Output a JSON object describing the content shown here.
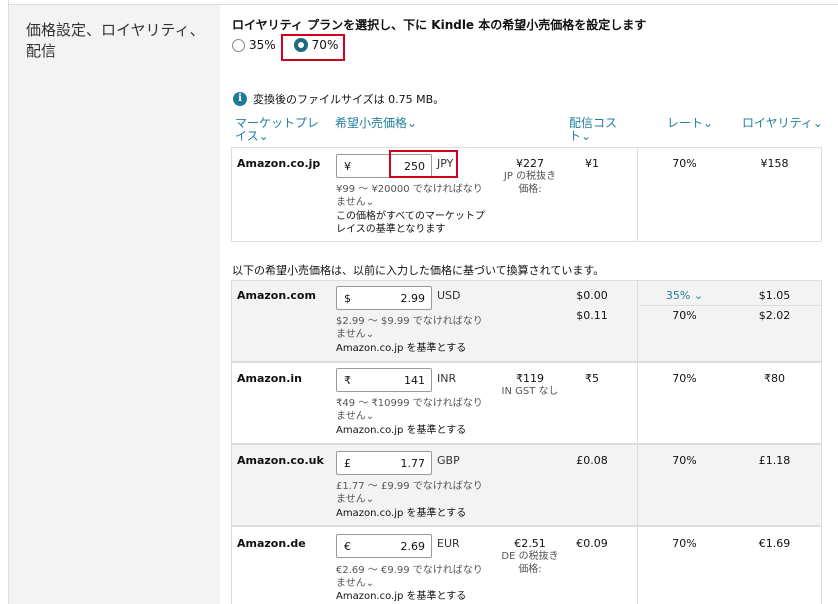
{
  "section": {
    "title": "価格設定、ロイヤリティ、配信"
  },
  "royalty": {
    "heading": "ロイヤリティ プランを選択し、下に Kindle 本の希望小売価格を設定します",
    "option_35": "35%",
    "option_70": "70%",
    "selected": "70%"
  },
  "info": {
    "text": "変換後のファイルサイズは 0.75 MB。"
  },
  "columns": {
    "marketplace": "マーケットプレイス⌄",
    "list_price": "希望小売価格⌄",
    "delivery_cost": "配信コスト⌄",
    "rate": "レート⌄",
    "royalty": "ロイヤリティ⌄"
  },
  "primary": {
    "marketplace": "Amazon.co.jp",
    "symbol": "¥",
    "price": "250",
    "currency": "JPY",
    "range": "¥99 ～ ¥20000 でなければなりません⌄",
    "base_note": "この価格がすべてのマーケットプレイスの基準となります",
    "tax_price": "¥227",
    "tax_note": "JP の税抜き価格:",
    "delivery": "¥1",
    "rate": "70%",
    "royalty": "¥158"
  },
  "converted_note": "以下の希望小売価格は、以前に入力した価格に基づいて換算されています。",
  "rows": [
    {
      "marketplace": "Amazon.com",
      "symbol": "$",
      "price": "2.99",
      "currency": "USD",
      "range": "$2.99 ～ $9.99 でなければなりません⌄",
      "base": "Amazon.co.jp を基準とする",
      "tax_price": "",
      "tax_note": "",
      "delivery": "$0.00",
      "delivery2": "$0.11",
      "rate": "35% ⌄",
      "rate2": "70%",
      "royalty": "$1.05",
      "royalty2": "$2.02"
    },
    {
      "marketplace": "Amazon.in",
      "symbol": "₹",
      "price": "141",
      "currency": "INR",
      "range": "₹49 ～ ₹10999 でなければなりません⌄",
      "base": "Amazon.co.jp を基準とする",
      "tax_price": "₹119",
      "tax_note": "IN GST なし",
      "delivery": "₹5",
      "rate": "70%",
      "royalty": "₹80"
    },
    {
      "marketplace": "Amazon.co.uk",
      "symbol": "£",
      "price": "1.77",
      "currency": "GBP",
      "range": "£1.77 ～ £9.99 でなければなりません⌄",
      "base": "Amazon.co.jp を基準とする",
      "tax_price": "",
      "tax_note": "",
      "delivery": "£0.08",
      "rate": "70%",
      "royalty": "£1.18"
    },
    {
      "marketplace": "Amazon.de",
      "symbol": "€",
      "price": "2.69",
      "currency": "EUR",
      "range": "€2.69 ～ €9.99 でなければなりません⌄",
      "base": "Amazon.co.jp を基準とする",
      "tax_price": "€2.51",
      "tax_note": "DE の税抜き価格:",
      "delivery": "€0.09",
      "rate": "70%",
      "royalty": "€1.69"
    }
  ],
  "colors": {
    "accent": "#1f7fa0",
    "highlight": "#d0021b",
    "row_gray": "#f3f3f3"
  }
}
